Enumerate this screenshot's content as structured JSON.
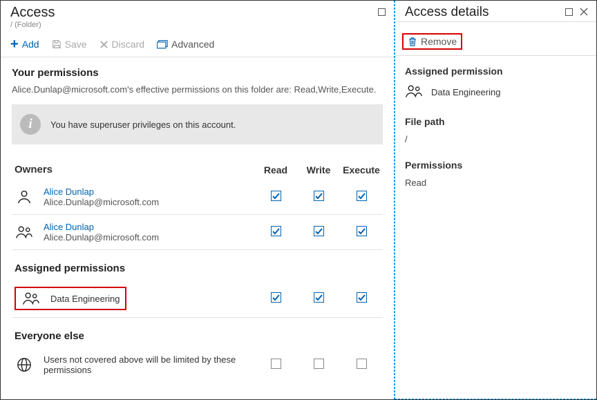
{
  "leftPanel": {
    "title": "Access",
    "subtitle": "/ (Folder)"
  },
  "toolbar": {
    "add": "Add",
    "save": "Save",
    "discard": "Discard",
    "advanced": "Advanced"
  },
  "yourPermissions": {
    "heading": "Your permissions",
    "desc": "Alice.Dunlap@microsoft.com's effective permissions on this folder are: Read,Write,Execute.",
    "info": "You have superuser privileges on this account."
  },
  "tableHeaders": {
    "owners": "Owners",
    "read": "Read",
    "write": "Write",
    "execute": "Execute"
  },
  "owners": [
    {
      "name": "Alice Dunlap",
      "sub": "Alice.Dunlap@microsoft.com",
      "kind": "user",
      "read": true,
      "write": true,
      "execute": true
    },
    {
      "name": "Alice Dunlap",
      "sub": "Alice.Dunlap@microsoft.com",
      "kind": "group",
      "read": true,
      "write": true,
      "execute": true
    }
  ],
  "assigned": {
    "heading": "Assigned permissions",
    "items": [
      {
        "name": "Data Engineering",
        "kind": "group",
        "read": true,
        "write": true,
        "execute": true
      }
    ]
  },
  "everyone": {
    "heading": "Everyone else",
    "desc": "Users not covered above will be limited by these permissions",
    "read": false,
    "write": false,
    "execute": false
  },
  "details": {
    "title": "Access details",
    "remove": "Remove",
    "assignedHeading": "Assigned permission",
    "assignedName": "Data Engineering",
    "filePathHeading": "File path",
    "filePath": "/",
    "permsHeading": "Permissions",
    "perms": "Read"
  }
}
